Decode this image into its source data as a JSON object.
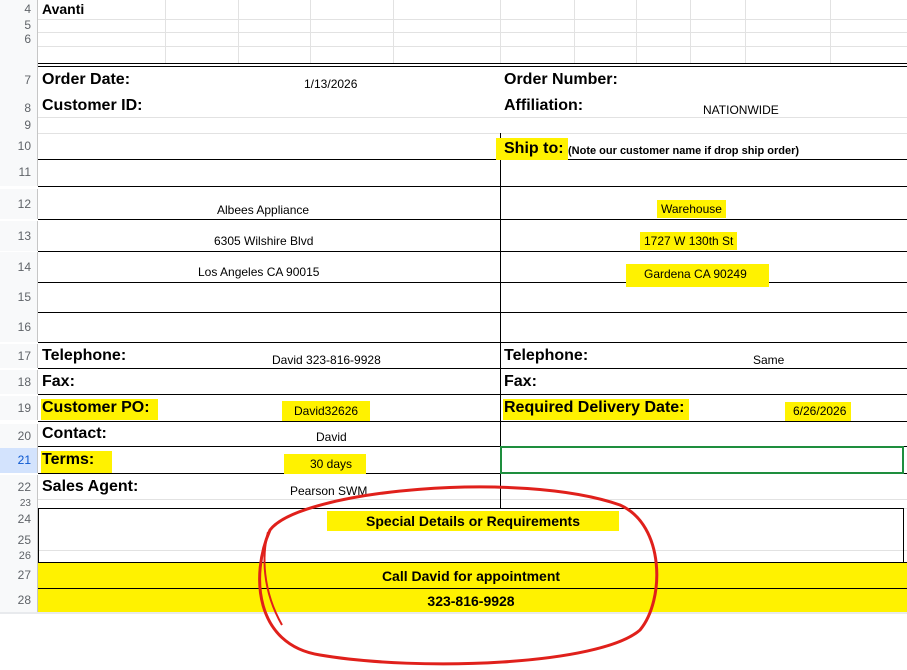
{
  "rows": [
    "4",
    "5",
    "6",
    "7",
    "8",
    "9",
    "10",
    "11",
    "12",
    "13",
    "14",
    "15",
    "16",
    "17",
    "18",
    "19",
    "20",
    "21",
    "22",
    "23",
    "24",
    "25",
    "26",
    "27",
    "28"
  ],
  "company": "Avanti",
  "order_date_label": "Order Date:",
  "order_date": "1/13/2026",
  "order_number_label": "Order Number:",
  "customer_id_label": "Customer ID:",
  "affiliation_label": "Affiliation:",
  "affiliation": "NATIONWIDE",
  "ship_to_label": "Ship to:",
  "ship_to_note": "(Note our customer name if drop ship order)",
  "bill_name": "Albees Appliance",
  "bill_addr1": "6305 Wilshire Blvd",
  "bill_addr2": "Los Angeles CA 90015",
  "ship_name": "Warehouse",
  "ship_addr1": "1727 W 130th St",
  "ship_addr2": "Gardena CA 90249",
  "telephone_label": "Telephone:",
  "telephone": "David 323-816-9928",
  "telephone2_label": "Telephone:",
  "telephone2": "Same",
  "fax_label": "Fax:",
  "fax2_label": "Fax:",
  "customer_po_label": "Customer PO:",
  "customer_po": "David32626",
  "req_delivery_label": "Required Delivery Date:",
  "req_delivery": "6/26/2026",
  "contact_label": "Contact:",
  "contact": "David",
  "terms_label": "Terms:",
  "terms": "30 days",
  "sales_agent_label": "Sales Agent:",
  "sales_agent": "Pearson SWM",
  "special_label": "Special Details or Requirements",
  "special_line1": "Call David for appointment",
  "special_line2": "323-816-9928",
  "colors": {
    "highlight": "#fff200",
    "annotation": "#e0201b",
    "selection": "#1e8e3e"
  }
}
